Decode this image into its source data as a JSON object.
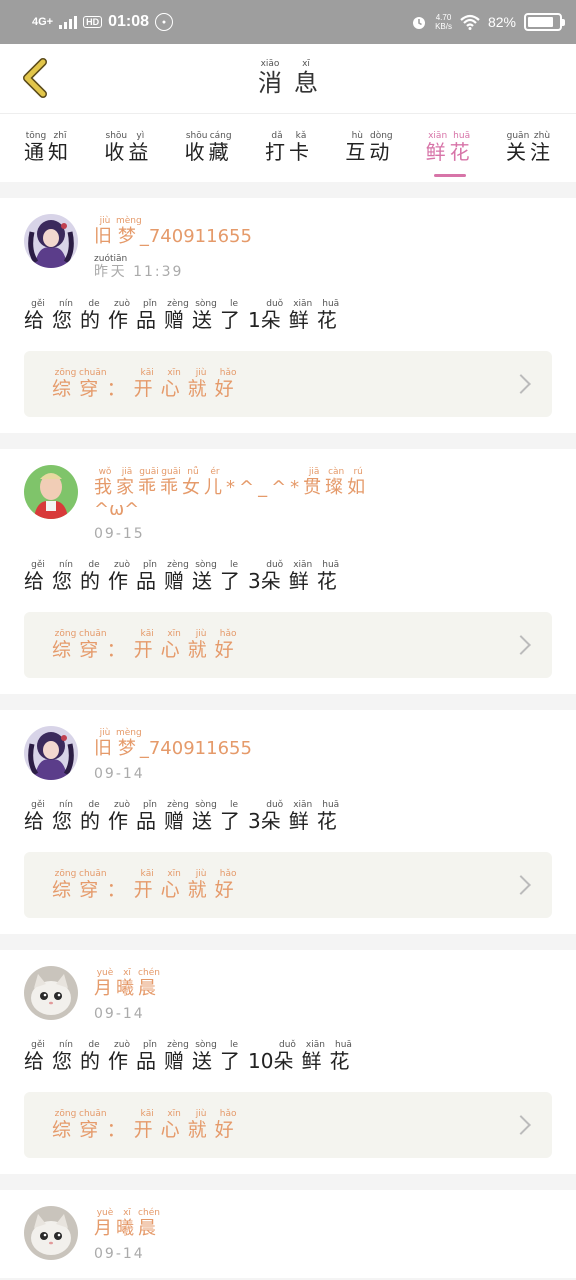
{
  "status_bar": {
    "network": "4G+",
    "hd_badge": "HD",
    "time": "01:08",
    "speed_value": "4.70",
    "speed_unit": "KB/s",
    "battery": "82%",
    "battery_level": 0.82,
    "icons": [
      "signal-icon",
      "alarm-icon",
      "wifi-icon",
      "battery-icon"
    ]
  },
  "header": {
    "title_chars": [
      {
        "ch": "消",
        "py": "xiāo"
      },
      {
        "ch": "息",
        "py": "xī"
      }
    ]
  },
  "tabs": [
    {
      "chars": [
        {
          "ch": "通",
          "py": "tōng"
        },
        {
          "ch": "知",
          "py": "zhī"
        }
      ]
    },
    {
      "chars": [
        {
          "ch": "收",
          "py": "shōu"
        },
        {
          "ch": "益",
          "py": "yì"
        }
      ]
    },
    {
      "chars": [
        {
          "ch": "收",
          "py": "shōu"
        },
        {
          "ch": "藏",
          "py": "cáng"
        }
      ]
    },
    {
      "chars": [
        {
          "ch": "打",
          "py": "dǎ"
        },
        {
          "ch": "卡",
          "py": "kǎ"
        }
      ]
    },
    {
      "chars": [
        {
          "ch": "互",
          "py": "hù"
        },
        {
          "ch": "动",
          "py": "dòng"
        }
      ]
    },
    {
      "chars": [
        {
          "ch": "鲜",
          "py": "xiān"
        },
        {
          "ch": "花",
          "py": "huā"
        }
      ],
      "active": true
    },
    {
      "chars": [
        {
          "ch": "关",
          "py": "guān"
        },
        {
          "ch": "注",
          "py": "zhù"
        }
      ]
    }
  ],
  "messages": [
    {
      "user": {
        "chars": [
          {
            "ch": "旧",
            "py": "jiù"
          },
          {
            "ch": "梦",
            "py": "mèng"
          }
        ],
        "suffix": "_740911655"
      },
      "time_chars": [
        {
          "ch": "昨",
          "py": "zuó"
        },
        {
          "ch": "天",
          "py": "tiān"
        }
      ],
      "time": "11:39",
      "msg_chars": [
        {
          "ch": "给",
          "py": "gěi"
        },
        {
          "ch": "您",
          "py": "nín"
        },
        {
          "ch": "的",
          "py": "de"
        },
        {
          "ch": "作",
          "py": "zuò"
        },
        {
          "ch": "品",
          "py": "pǐn"
        },
        {
          "ch": "赠",
          "py": "zèng"
        },
        {
          "ch": "送",
          "py": "sòng"
        },
        {
          "ch": "了",
          "py": "le"
        }
      ],
      "count": "1",
      "tail_chars": [
        {
          "ch": "朵",
          "py": "duǒ"
        },
        {
          "ch": "鲜",
          "py": "xiān"
        },
        {
          "ch": "花",
          "py": "huā"
        }
      ],
      "work_chars": [
        {
          "ch": "综",
          "py": "zōng"
        },
        {
          "ch": "穿",
          "py": "chuān"
        },
        {
          "ch": "：",
          "py": ""
        },
        {
          "ch": "开",
          "py": "kāi"
        },
        {
          "ch": "心",
          "py": "xīn"
        },
        {
          "ch": "就",
          "py": "jiù"
        },
        {
          "ch": "好",
          "py": "hǎo"
        }
      ],
      "avatar": "anime-avatar"
    },
    {
      "user": {
        "chars": [
          {
            "ch": "我",
            "py": "wǒ"
          },
          {
            "ch": "家",
            "py": "jiā"
          },
          {
            "ch": "乖",
            "py": "guāi"
          },
          {
            "ch": "乖",
            "py": "guāi"
          },
          {
            "ch": "女",
            "py": "nǚ"
          },
          {
            "ch": "儿",
            "py": "ér"
          },
          {
            "ch": "*^_^*",
            "py": ""
          },
          {
            "ch": "贯",
            "py": "jiā"
          },
          {
            "ch": "璨",
            "py": "càn"
          },
          {
            "ch": "如",
            "py": "rú"
          }
        ],
        "suffix": "^ω^"
      },
      "time_chars": [],
      "time": "09-15",
      "msg_chars": [
        {
          "ch": "给",
          "py": "gěi"
        },
        {
          "ch": "您",
          "py": "nín"
        },
        {
          "ch": "的",
          "py": "de"
        },
        {
          "ch": "作",
          "py": "zuò"
        },
        {
          "ch": "品",
          "py": "pǐn"
        },
        {
          "ch": "赠",
          "py": "zèng"
        },
        {
          "ch": "送",
          "py": "sòng"
        },
        {
          "ch": "了",
          "py": "le"
        }
      ],
      "count": "3",
      "tail_chars": [
        {
          "ch": "朵",
          "py": "duǒ"
        },
        {
          "ch": "鲜",
          "py": "xiān"
        },
        {
          "ch": "花",
          "py": "huā"
        }
      ],
      "work_chars": [
        {
          "ch": "综",
          "py": "zōng"
        },
        {
          "ch": "穿",
          "py": "chuān"
        },
        {
          "ch": "：",
          "py": ""
        },
        {
          "ch": "开",
          "py": "kāi"
        },
        {
          "ch": "心",
          "py": "xīn"
        },
        {
          "ch": "就",
          "py": "jiù"
        },
        {
          "ch": "好",
          "py": "hǎo"
        }
      ],
      "avatar": "child-avatar"
    },
    {
      "user": {
        "chars": [
          {
            "ch": "旧",
            "py": "jiù"
          },
          {
            "ch": "梦",
            "py": "mèng"
          }
        ],
        "suffix": "_740911655"
      },
      "time_chars": [],
      "time": "09-14",
      "msg_chars": [
        {
          "ch": "给",
          "py": "gěi"
        },
        {
          "ch": "您",
          "py": "nín"
        },
        {
          "ch": "的",
          "py": "de"
        },
        {
          "ch": "作",
          "py": "zuò"
        },
        {
          "ch": "品",
          "py": "pǐn"
        },
        {
          "ch": "赠",
          "py": "zèng"
        },
        {
          "ch": "送",
          "py": "sòng"
        },
        {
          "ch": "了",
          "py": "le"
        }
      ],
      "count": "3",
      "tail_chars": [
        {
          "ch": "朵",
          "py": "duǒ"
        },
        {
          "ch": "鲜",
          "py": "xiān"
        },
        {
          "ch": "花",
          "py": "huā"
        }
      ],
      "work_chars": [
        {
          "ch": "综",
          "py": "zōng"
        },
        {
          "ch": "穿",
          "py": "chuān"
        },
        {
          "ch": "：",
          "py": ""
        },
        {
          "ch": "开",
          "py": "kāi"
        },
        {
          "ch": "心",
          "py": "xīn"
        },
        {
          "ch": "就",
          "py": "jiù"
        },
        {
          "ch": "好",
          "py": "hǎo"
        }
      ],
      "avatar": "anime-avatar"
    },
    {
      "user": {
        "chars": [
          {
            "ch": "月",
            "py": "yuè"
          },
          {
            "ch": "曦",
            "py": "xī"
          },
          {
            "ch": "晨",
            "py": "chén"
          }
        ],
        "suffix": ""
      },
      "time_chars": [],
      "time": "09-14",
      "msg_chars": [
        {
          "ch": "给",
          "py": "gěi"
        },
        {
          "ch": "您",
          "py": "nín"
        },
        {
          "ch": "的",
          "py": "de"
        },
        {
          "ch": "作",
          "py": "zuò"
        },
        {
          "ch": "品",
          "py": "pǐn"
        },
        {
          "ch": "赠",
          "py": "zèng"
        },
        {
          "ch": "送",
          "py": "sòng"
        },
        {
          "ch": "了",
          "py": "le"
        }
      ],
      "count": "10",
      "tail_chars": [
        {
          "ch": "朵",
          "py": "duǒ"
        },
        {
          "ch": "鲜",
          "py": "xiān"
        },
        {
          "ch": "花",
          "py": "huā"
        }
      ],
      "work_chars": [
        {
          "ch": "综",
          "py": "zōng"
        },
        {
          "ch": "穿",
          "py": "chuān"
        },
        {
          "ch": "：",
          "py": ""
        },
        {
          "ch": "开",
          "py": "kāi"
        },
        {
          "ch": "心",
          "py": "xīn"
        },
        {
          "ch": "就",
          "py": "jiù"
        },
        {
          "ch": "好",
          "py": "hǎo"
        }
      ],
      "avatar": "cat-avatar"
    },
    {
      "user": {
        "chars": [
          {
            "ch": "月",
            "py": "yuè"
          },
          {
            "ch": "曦",
            "py": "xī"
          },
          {
            "ch": "晨",
            "py": "chén"
          }
        ],
        "suffix": ""
      },
      "time_chars": [],
      "time": "09-14",
      "msg_chars": [],
      "count": "",
      "tail_chars": [],
      "work_chars": [],
      "avatar": "cat-avatar"
    }
  ],
  "colors": {
    "accent_pink": "#d774a8",
    "accent_orange": "#e59a6a",
    "status_bar": "#9e9e9e",
    "back_arrow": "#e2c64a"
  }
}
